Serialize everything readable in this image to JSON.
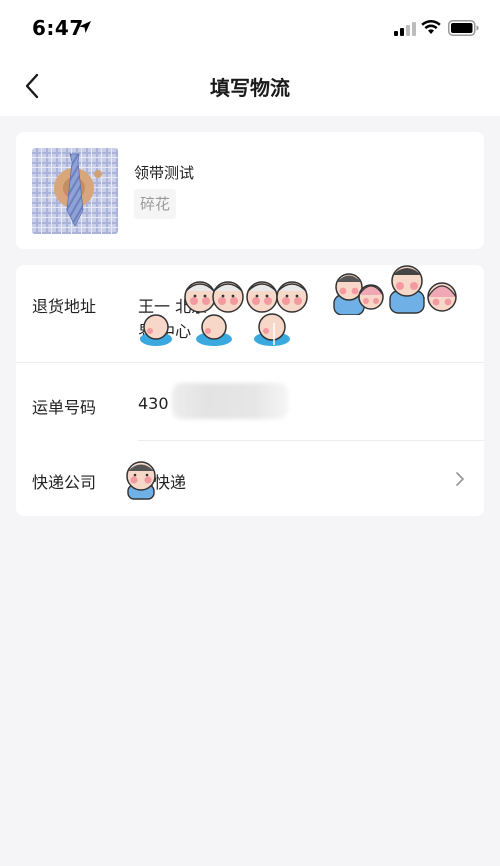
{
  "status_bar": {
    "time": "6:47"
  },
  "nav": {
    "title": "填写物流"
  },
  "product": {
    "name": "领带测试",
    "spec": "碎花"
  },
  "form": {
    "return_address": {
      "label": "退货地址",
      "line1": "王一        北京",
      "line2": "    界    中心"
    },
    "waybill": {
      "label": "运单号码",
      "value": "430"
    },
    "courier": {
      "label": "快递公司",
      "value": "   达快递"
    }
  },
  "colors": {
    "background": "#f5f5f7",
    "card": "#ffffff",
    "muted_text": "#9a9a9a"
  }
}
